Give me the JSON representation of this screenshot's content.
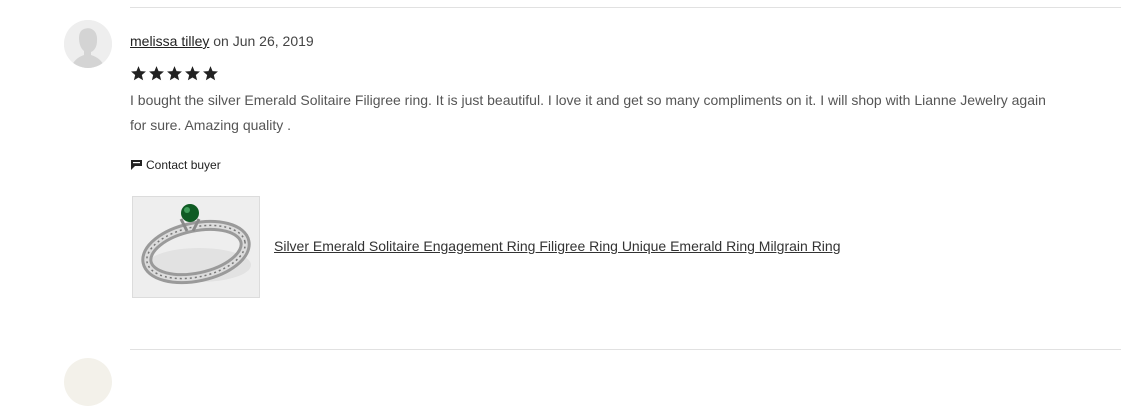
{
  "review": {
    "reviewer_name": "melissa tilley",
    "date_prefix": "on",
    "date": "Jun 26, 2019",
    "rating": 5,
    "rating_max": 5,
    "text": "I bought the silver Emerald Solitaire Filigree ring. It is just beautiful. I love it and get so many compliments on it. I will shop with Lianne Jewelry again for sure. Amazing quality .",
    "contact_label": "Contact buyer",
    "contact_icon": "chat-flag-icon",
    "avatar_icon": "default-user-silhouette-icon"
  },
  "product": {
    "title": "Silver Emerald Solitaire Engagement Ring Filigree Ring Unique Emerald Ring Milgrain Ring",
    "thumbnail_subject": "silver ring with emerald stone"
  },
  "colors": {
    "star": "#222222",
    "divider": "#e1e1e1",
    "link_text": "#333333",
    "emerald": "#0f5b24"
  }
}
